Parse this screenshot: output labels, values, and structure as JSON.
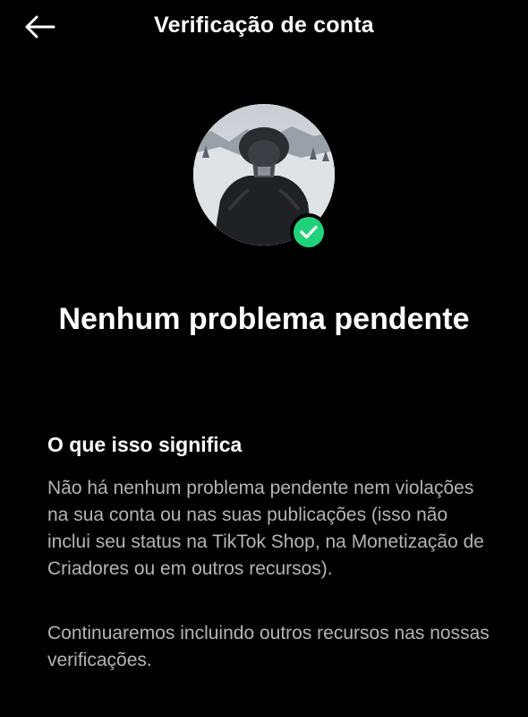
{
  "header": {
    "title": "Verificação de conta",
    "back_icon": "arrow-left-icon"
  },
  "profile": {
    "avatar_icon": "profile-photo",
    "badge_icon": "check-circle-icon",
    "badge_color": "#20d37a"
  },
  "status": {
    "title": "Nenhum problema pendente"
  },
  "info": {
    "heading": "O que isso significa",
    "paragraph_1": "Não há nenhum problema pendente nem violações na sua conta ou nas suas publicações (isso não inclui seu status na TikTok Shop, na Monetização de Criadores ou em outros recursos).",
    "paragraph_2": "Continuaremos incluindo outros recursos nas nossas verificações."
  },
  "colors": {
    "background": "#000000",
    "text_primary": "#ffffff",
    "text_secondary": "#b4b4b4"
  }
}
